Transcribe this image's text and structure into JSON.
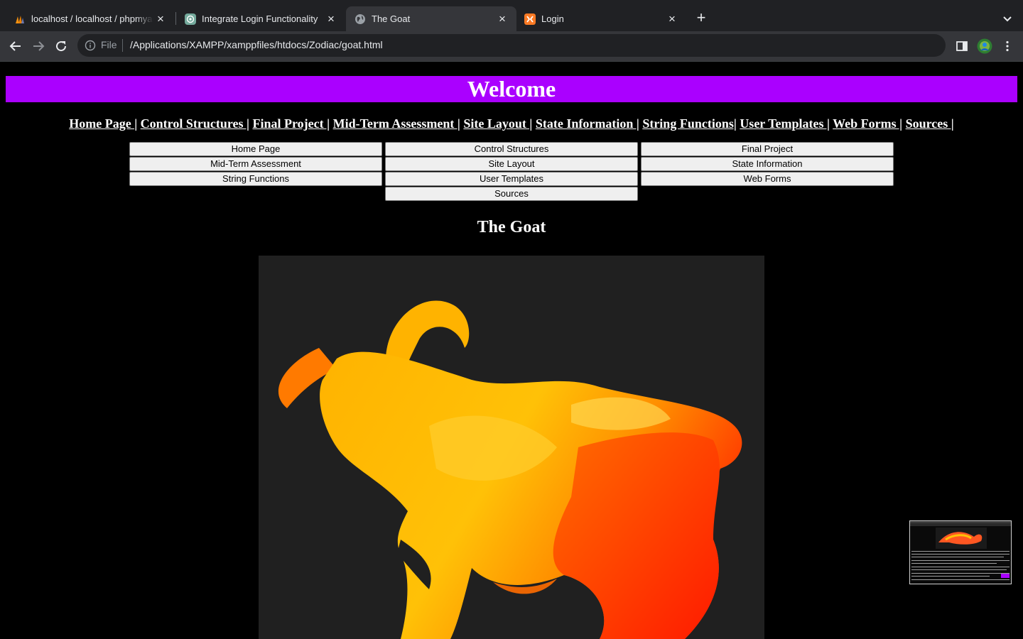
{
  "browser": {
    "tabs": [
      {
        "title": "localhost / localhost / phpmyadmin",
        "favicon": "phpmyadmin-icon",
        "active": false
      },
      {
        "title": "Integrate Login Functionality",
        "favicon": "chatgpt-icon",
        "active": false
      },
      {
        "title": "The Goat",
        "favicon": "globe-icon",
        "active": true
      },
      {
        "title": "Login",
        "favicon": "xampp-icon",
        "active": false
      }
    ],
    "address": {
      "scheme_label": "File",
      "url": "/Applications/XAMPP/xamppfiles/htdocs/Zodiac/goat.html"
    }
  },
  "page": {
    "banner_title": "Welcome",
    "banner_color": "#aa00ff",
    "nav_links": [
      "Home Page |",
      "Control Structures |",
      "Final Project |",
      "Mid-Term Assessment |",
      "Site Layout |",
      "State Information |",
      "String Functions|",
      "User Templates |",
      "Web Forms |",
      "Sources |"
    ],
    "nav_buttons": [
      "Home Page",
      "Control Structures",
      "Final Project",
      "Mid-Term Assessment",
      "Site Layout",
      "State Information",
      "String Functions",
      "User Templates",
      "Web Forms",
      "Sources"
    ],
    "heading": "The Goat",
    "image": {
      "subject": "goat-zodiac-illustration",
      "colors": [
        "#ffc107",
        "#ff9800",
        "#ff3d00"
      ]
    }
  }
}
